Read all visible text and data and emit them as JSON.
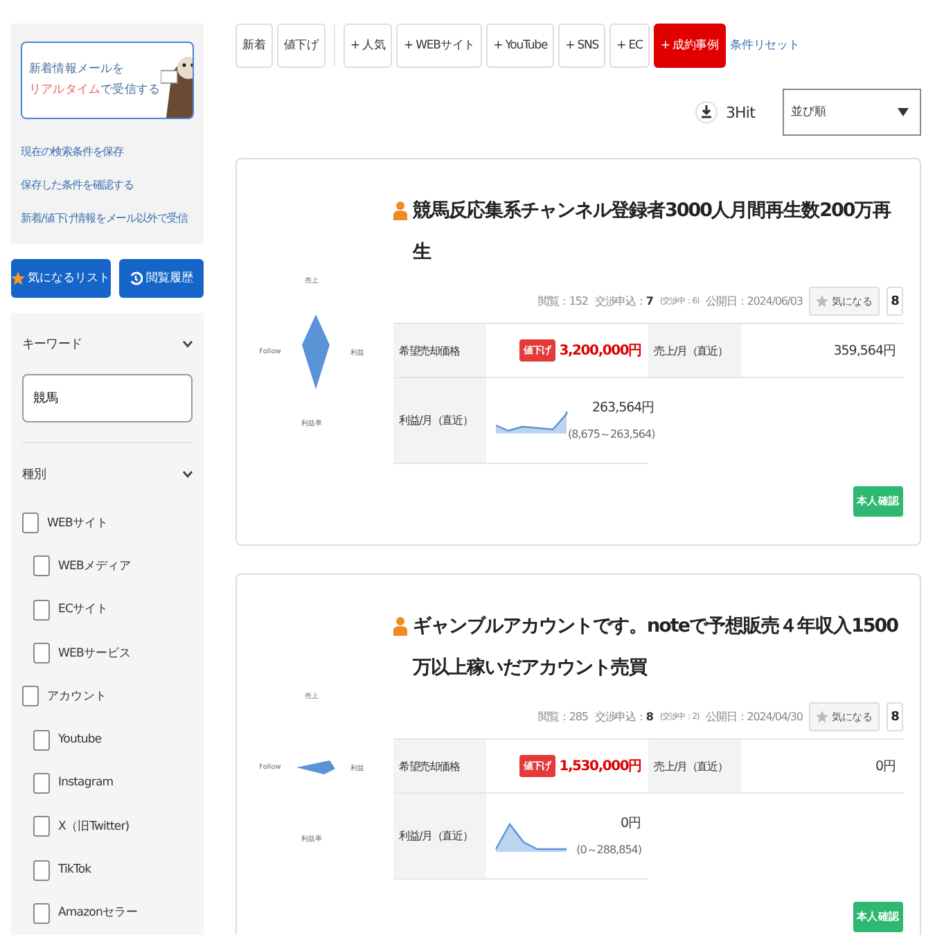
{
  "sidebar": {
    "banner": {
      "line1": "新着情報メールを",
      "highlight": "リアルタイム",
      "rest": "で受信する"
    },
    "links": [
      "現在の検索条件を保存",
      "保存した条件を確認する",
      "新着/値下げ情報をメール以外で受信"
    ],
    "favorites_button": "気になるリスト",
    "history_button": "閲覧履歴",
    "keyword": {
      "title": "キーワード",
      "expanded": true,
      "value": "競馬"
    },
    "category": {
      "title": "種別",
      "expanded": true,
      "options": [
        {
          "label": "WEBサイト",
          "checked": false,
          "children": [
            {
              "label": "WEBメディア",
              "checked": false
            },
            {
              "label": "ECサイト",
              "checked": false
            },
            {
              "label": "WEBサービス",
              "checked": false
            }
          ]
        },
        {
          "label": "アカウント",
          "checked": false,
          "children": [
            {
              "label": "Youtube",
              "checked": false
            },
            {
              "label": "Instagram",
              "checked": false
            },
            {
              "label": "X（旧Twitter)",
              "checked": false
            },
            {
              "label": "TikTok",
              "checked": false
            },
            {
              "label": "Amazonセラー",
              "checked": false
            }
          ]
        }
      ]
    }
  },
  "filters": {
    "primary": [
      {
        "label": "新着",
        "selected": false
      },
      {
        "label": "値下げ",
        "selected": false
      }
    ],
    "categories": [
      {
        "label": "+ 人気",
        "selected": false
      },
      {
        "label": "+ WEBサイト",
        "selected": false
      },
      {
        "label": "+ YouTube",
        "selected": false
      },
      {
        "label": "+ SNS",
        "selected": false
      },
      {
        "label": "+ EC",
        "selected": false
      },
      {
        "label": "+ 成約事例",
        "selected": true
      }
    ],
    "reset": "条件リセット"
  },
  "hits": "3Hit",
  "sort": {
    "placeholder": "並び順"
  },
  "listings": [
    {
      "title": "競馬反応集系チャンネル登録者3000人月間再生数200万再生",
      "radar": {
        "kind": "diamond",
        "labels": [
          "売上",
          "利益",
          "利益率",
          "Follow"
        ]
      },
      "views": "閲覧：152",
      "offers_label": "交渉申込：",
      "offers": "7",
      "negotiating": "(交渉中：6)",
      "published": "公開日：2024/06/03",
      "favorite": "気になる",
      "favorite_count": "8",
      "price_label": "希望売却価格",
      "price_badge": "値下げ",
      "price": "3,200,000円",
      "sales_label": "売上/月（直近）",
      "sales": "359,564円",
      "profit_label": "利益/月（直近）",
      "sparkline": {
        "kind": "rising"
      },
      "profit": "263,564円",
      "profit_range": "(8,675～263,564)",
      "verified": "本人確認"
    },
    {
      "title": "ギャンブルアカウントです。noteで予想販売４年収入1500万以上稼いだアカウント売買",
      "radar": {
        "kind": "wedge",
        "labels": [
          "売上",
          "利益",
          "利益率",
          "Follow"
        ]
      },
      "views": "閲覧：285",
      "offers_label": "交渉申込：",
      "offers": "8",
      "negotiating": "(交渉中：2)",
      "published": "公開日：2024/04/30",
      "favorite": "気になる",
      "favorite_count": "8",
      "price_label": "希望売却価格",
      "price_badge": "値下げ",
      "price": "1,530,000円",
      "sales_label": "売上/月（直近）",
      "sales": "0円",
      "profit_label": "利益/月（直近）",
      "sparkline": {
        "kind": "peak"
      },
      "profit": "0円",
      "profit_range": "(0～288,854)",
      "verified": "本人確認"
    }
  ]
}
